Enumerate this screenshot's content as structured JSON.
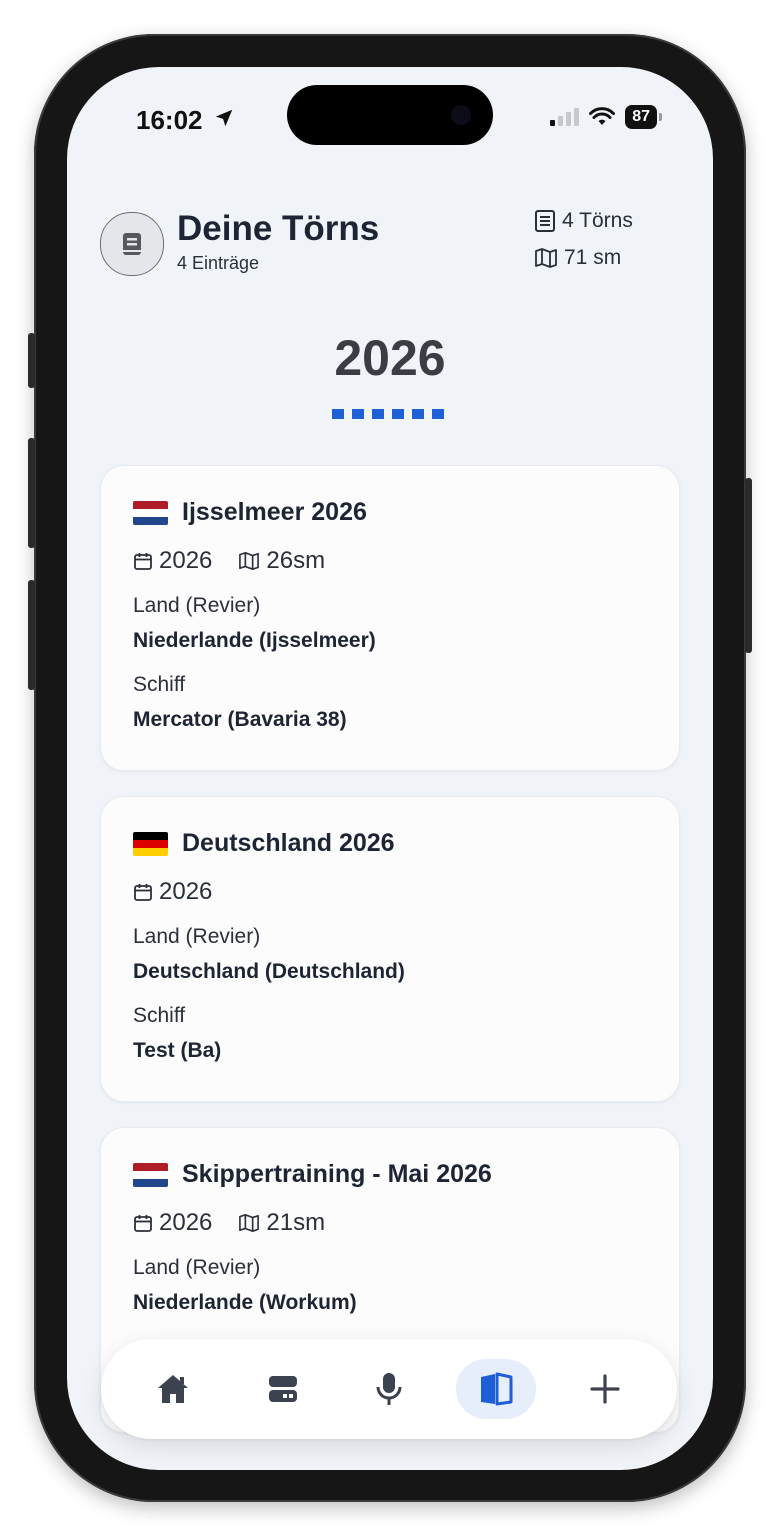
{
  "status_bar": {
    "time": "16:02",
    "battery": "87"
  },
  "header": {
    "title": "Deine Törns",
    "subtitle": "4 Einträge",
    "stat_trips": "4 Törns",
    "stat_distance": "71 sm"
  },
  "year": "2026",
  "cards": [
    {
      "title": "Ijsselmeer 2026",
      "flag": "netherlands",
      "year": "2026",
      "distance": "26sm",
      "land_label": "Land (Revier)",
      "land_value": "Niederlande (Ijsselmeer)",
      "ship_label": "Schiff",
      "ship_value": "Mercator (Bavaria 38)"
    },
    {
      "title": "Deutschland 2026",
      "flag": "germany",
      "year": "2026",
      "land_label": "Land (Revier)",
      "land_value": "Deutschland (Deutschland)",
      "ship_label": "Schiff",
      "ship_value": "Test (Ba)"
    },
    {
      "title": "Skippertraining - Mai 2026",
      "flag": "netherlands",
      "year": "2026",
      "distance": "21sm",
      "land_label": "Land (Revier)",
      "land_value": "Niederlande (Workum)"
    }
  ],
  "nav": {
    "items": [
      "home-icon",
      "boat-icon",
      "microphone-icon",
      "logbook-icon",
      "plus-icon"
    ],
    "active": "logbook-icon"
  },
  "colors": {
    "accent": "#1f5fd6",
    "background": "#f0f4f8",
    "card": "#fcfcfd",
    "nav_active_bg": "#e6eefb"
  }
}
